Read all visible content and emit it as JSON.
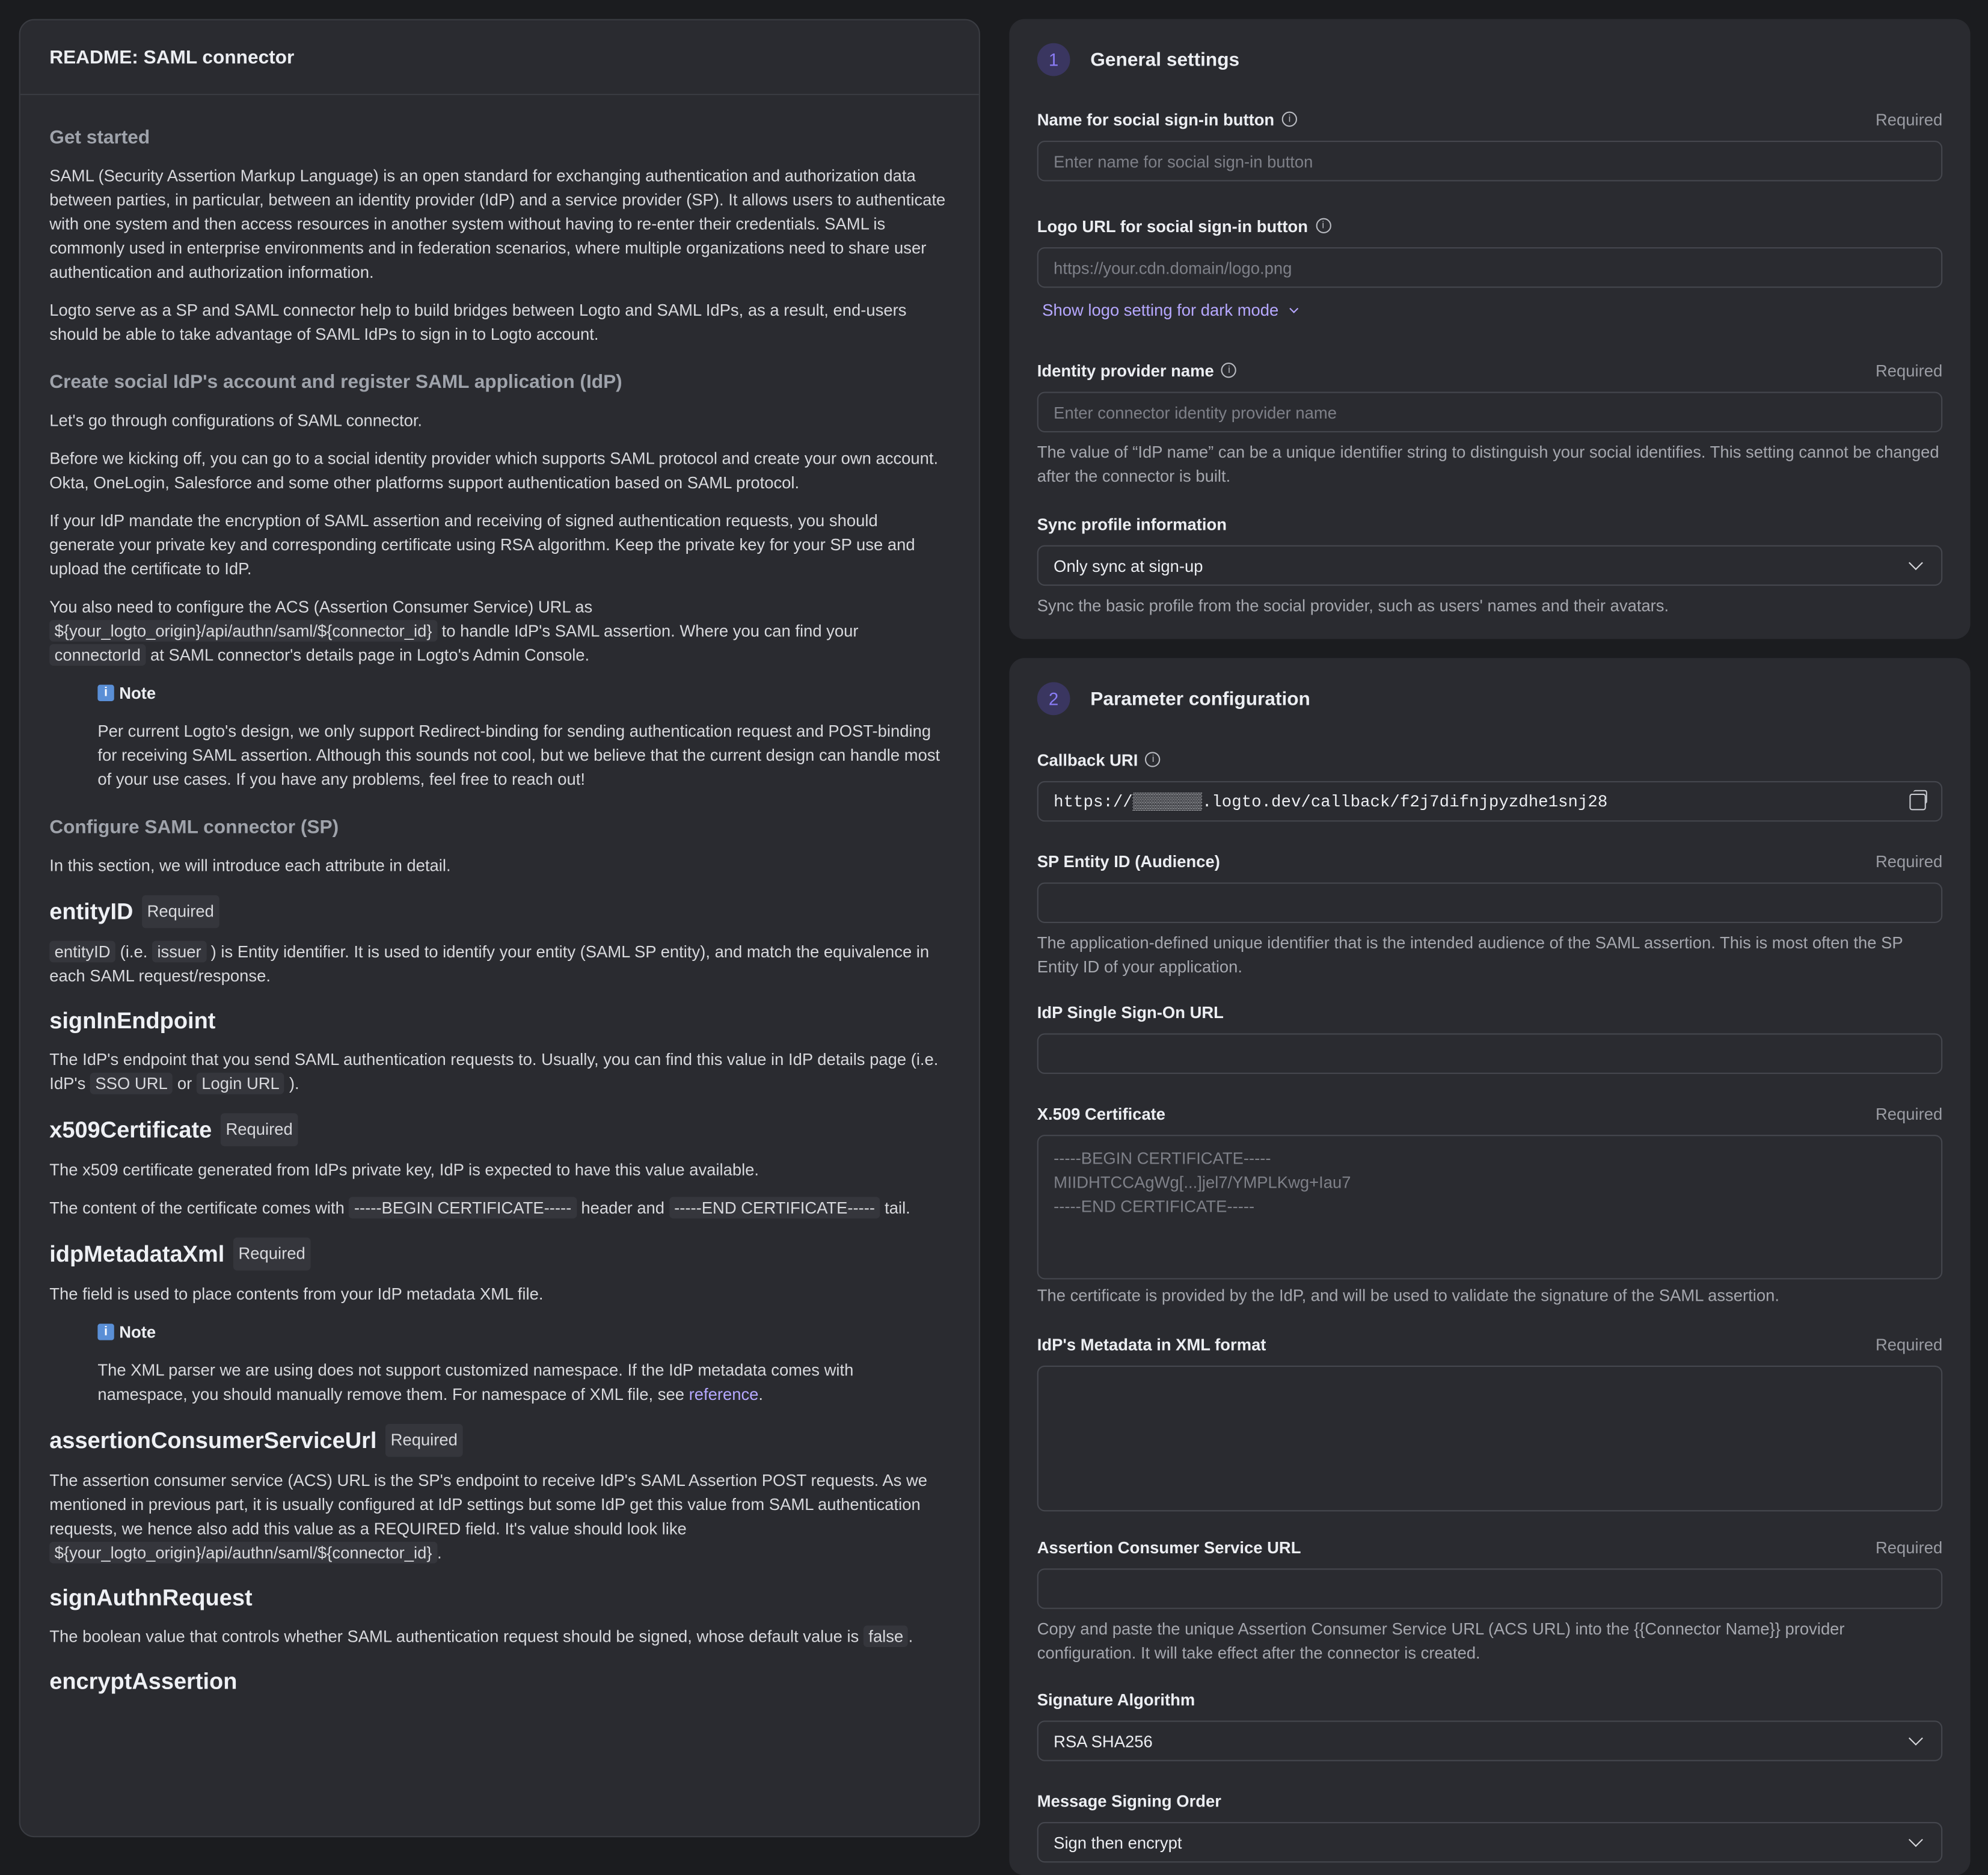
{
  "readme": {
    "title": "README: SAML connector",
    "get_started": "Get started",
    "p1": "SAML (Security Assertion Markup Language) is an open standard for exchanging authentication and authorization data between parties, in particular, between an identity provider (IdP) and a service provider (SP). It allows users to authenticate with one system and then access resources in another system without having to re-enter their credentials. SAML is commonly used in enterprise environments and in federation scenarios, where multiple organizations need to share user authentication and authorization information.",
    "p2": "Logto serve as a SP and SAML connector help to build bridges between Logto and SAML IdPs, as a result, end-users should be able to take advantage of SAML IdPs to sign in to Logto account.",
    "create_heading": "Create social IdP's account and register SAML application (IdP)",
    "p3": "Let's go through configurations of SAML connector.",
    "p4": "Before we kicking off, you can go to a social identity provider which supports SAML protocol and create your own account. Okta, OneLogin, Salesforce and some other platforms support authentication based on SAML protocol.",
    "p5": "If your IdP mandate the encryption of SAML assertion and receiving of signed authentication requests, you should generate your private key and corresponding certificate using RSA algorithm. Keep the private key for your SP use and upload the certificate to IdP.",
    "p6_a": "You also need to configure the ACS (Assertion Consumer Service) URL as",
    "p6_code1": "${your_logto_origin}/api/authn/saml/${connector_id}",
    "p6_b": "to handle IdP's SAML assertion. Where you can find your",
    "p6_code2": "connectorId",
    "p6_c": "at SAML connector's details page in Logto's Admin Console.",
    "note_label": "Note",
    "note_icon_glyph": "i",
    "note1": "Per current Logto's design, we only support Redirect-binding for sending authentication request and POST-binding for receiving SAML assertion. Although this sounds not cool, but we believe that the current design can handle most of your use cases. If you have any problems, feel free to reach out!",
    "configure_heading": "Configure SAML connector (SP)",
    "p7": "In this section, we will introduce each attribute in detail.",
    "required_tag": "Required",
    "entity_h": "entityID",
    "entity_code1": "entityID",
    "entity_a": "(i.e.",
    "entity_code2": "issuer",
    "entity_b": ") is Entity identifier. It is used to identify your entity (SAML SP entity), and match the equivalence in each SAML request/response.",
    "signin_h": "signInEndpoint",
    "signin_a": "The IdP's endpoint that you send SAML authentication requests to. Usually, you can find this value in IdP details page (i.e. IdP's",
    "signin_code1": "SSO URL",
    "signin_or": "or",
    "signin_code2": "Login URL",
    "signin_b": ").",
    "x509_h": "x509Certificate",
    "x509_p1": "The x509 certificate generated from IdPs private key, IdP is expected to have this value available.",
    "x509_p2_a": "The content of the certificate comes with",
    "x509_code1": "-----BEGIN CERTIFICATE-----",
    "x509_p2_b": "header and",
    "x509_code2": "-----END CERTIFICATE-----",
    "x509_p2_c": "tail.",
    "idp_h": "idpMetadataXml",
    "idp_p": "The field is used to place contents from your IdP metadata XML file.",
    "note2_a": "The XML parser we are using does not support customized namespace. If the IdP metadata comes with namespace, you should manually remove them. For namespace of XML file, see",
    "note2_link": "reference",
    "note2_b": ".",
    "acs_h": "assertionConsumerServiceUrl",
    "acs_p_a": "The assertion consumer service (ACS) URL is the SP's endpoint to receive IdP's SAML Assertion POST requests. As we mentioned in previous part, it is usually configured at IdP settings but some IdP get this value from SAML authentication requests, we hence also add this value as a REQUIRED field. It's value should look like",
    "acs_code": "${your_logto_origin}/api/authn/saml/${connector_id}",
    "acs_p_b": ".",
    "sign_h": "signAuthnRequest",
    "sign_p_a": "The boolean value that controls whether SAML authentication request should be signed, whose default value is",
    "sign_code": "false",
    "sign_p_b": ".",
    "encrypt_h": "encryptAssertion"
  },
  "general": {
    "step": "1",
    "title": "General settings",
    "required": "Required",
    "info_glyph": "i",
    "name_label": "Name for social sign-in button",
    "name_placeholder": "Enter name for social sign-in button",
    "logo_label": "Logo URL for social sign-in button",
    "logo_placeholder": "https://your.cdn.domain/logo.png",
    "dark_mode_link": "Show logo setting for dark mode",
    "idp_label": "Identity provider name",
    "idp_placeholder": "Enter connector identity provider name",
    "idp_hint": "The value of “IdP name” can be a unique identifier string to distinguish your social identifies. This setting cannot be changed after the connector is built.",
    "sync_label": "Sync profile information",
    "sync_value": "Only sync at sign-up",
    "sync_hint": "Sync the basic profile from the social provider, such as users' names and their avatars."
  },
  "params": {
    "step": "2",
    "title": "Parameter configuration",
    "required": "Required",
    "callback_label": "Callback URI",
    "callback_value": "https://▒▒▒▒▒▒▒.logto.dev/callback/f2j7difnjpyzdhe1snj28",
    "sp_label": "SP Entity ID (Audience)",
    "sp_hint": "The application-defined unique identifier that is the intended audience of the SAML assertion. This is most often the SP Entity ID of your application.",
    "sso_label": "IdP Single Sign-On URL",
    "cert_label": "X.509 Certificate",
    "cert_line1": "-----BEGIN CERTIFICATE-----",
    "cert_line2": "MIIDHTCCAgWg[...]jel7/YMPLKwg+Iau7",
    "cert_line3": "-----END CERTIFICATE-----",
    "cert_hint": "The certificate is provided by the IdP, and will be used to validate the signature of the SAML assertion.",
    "metadata_label": "IdP's Metadata in XML format",
    "acs_label": "Assertion Consumer Service URL",
    "acs_hint": "Copy and paste the unique Assertion Consumer Service URL (ACS URL) into the {{Connector Name}} provider configuration. It will take effect after the connector is created.",
    "sigalg_label": "Signature Algorithm",
    "sigalg_value": "RSA SHA256",
    "order_label": "Message Signing Order",
    "order_value": "Sign then encrypt"
  }
}
